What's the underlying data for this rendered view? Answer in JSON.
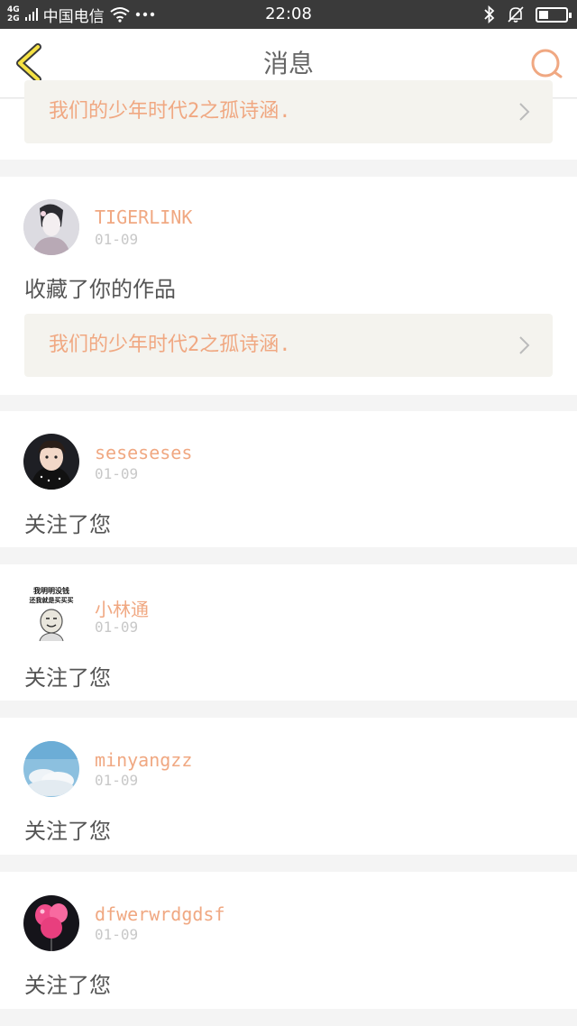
{
  "status": {
    "carrier": "中国电信",
    "net_top": "4G",
    "net_bottom": "2G",
    "time": "22:08",
    "battery_level": 0.35,
    "icons": [
      "signal-icon",
      "wifi-icon",
      "more-icon",
      "bluetooth-icon",
      "mute-bell-icon",
      "battery-icon"
    ]
  },
  "header": {
    "title": "消息"
  },
  "accent_color": "#f0a882",
  "items": [
    {
      "work_title": "我们的少年时代2之孤诗涵."
    },
    {
      "username": "TIGERLINK",
      "date": "01-09",
      "action": "收藏了你的作品",
      "work_title": "我们的少年时代2之孤诗涵."
    },
    {
      "username": "seseseses",
      "date": "01-09",
      "action": "关注了您"
    },
    {
      "username": "小林通",
      "date": "01-09",
      "action": "关注了您",
      "avatar_text_1": "我明明没钱",
      "avatar_text_2": "还我就是买买买"
    },
    {
      "username": "minyangzz",
      "date": "01-09",
      "action": "关注了您"
    },
    {
      "username": "dfwerwrdgdsf",
      "date": "01-09",
      "action": "关注了您"
    }
  ]
}
